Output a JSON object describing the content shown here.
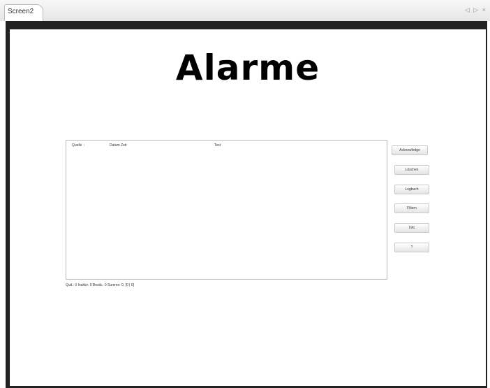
{
  "tab": {
    "title": "Screen2"
  },
  "window_controls": [
    "◁",
    "▷",
    "×"
  ],
  "page": {
    "title": "Alarme"
  },
  "alarm_view": {
    "columns": [
      "Quelle ↑",
      "Datum Zeit",
      "Text"
    ],
    "status": "Quit.: 0  Inaktiv: 0  Bestä.: 0  Summe: 0,  [0 | 0]"
  },
  "buttons": {
    "acknowledge": "Acknowledge",
    "button2": "Löschen",
    "button3": "Logbuch",
    "button4": "Filtern",
    "button5": "Info",
    "button6": "?"
  }
}
